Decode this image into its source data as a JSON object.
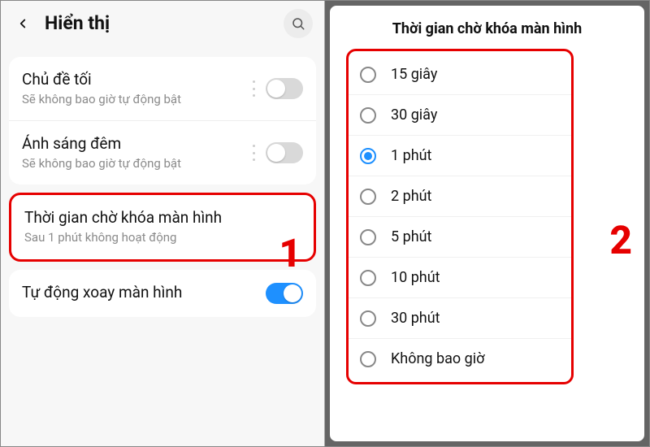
{
  "left": {
    "title": "Hiển thị",
    "rows": {
      "darkTheme": {
        "title": "Chủ đề tối",
        "sub": "Sẽ không bao giờ tự động bật"
      },
      "nightLight": {
        "title": "Ánh sáng đêm",
        "sub": "Sẽ không bao giờ tự động bật"
      },
      "screenTimeout": {
        "title": "Thời gian chờ khóa màn hình",
        "sub": "Sau 1 phút không hoạt động"
      },
      "autoRotate": {
        "title": "Tự động xoay màn hình"
      }
    },
    "callout": "1"
  },
  "right": {
    "title": "Thời gian chờ khóa màn hình",
    "options": [
      {
        "label": "15 giây",
        "checked": false
      },
      {
        "label": "30 giây",
        "checked": false
      },
      {
        "label": "1 phút",
        "checked": true
      },
      {
        "label": "2 phút",
        "checked": false
      },
      {
        "label": "5 phút",
        "checked": false
      },
      {
        "label": "10 phút",
        "checked": false
      },
      {
        "label": "30 phút",
        "checked": false
      },
      {
        "label": "Không bao giờ",
        "checked": false
      }
    ],
    "callout": "2"
  }
}
